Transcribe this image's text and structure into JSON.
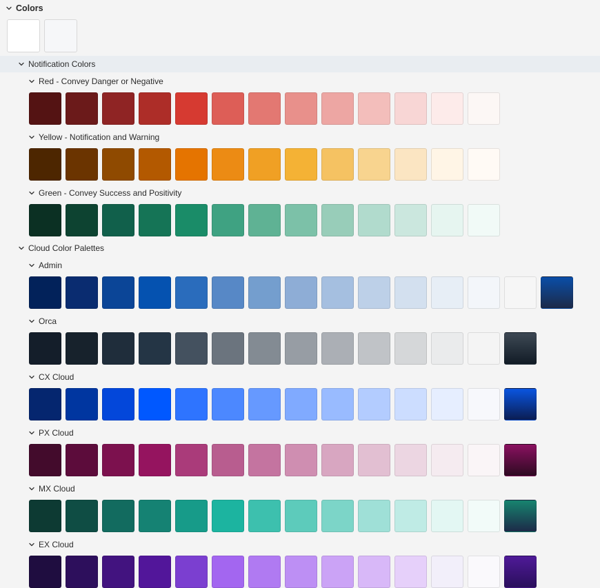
{
  "tree": {
    "root_title": "Colors",
    "notification_title": "Notification Colors",
    "cloud_title": "Cloud Color Palettes"
  },
  "top_swatches": [
    "#ffffff",
    "#f6f7f9"
  ],
  "groups": [
    {
      "title": "Red - Convey Danger or Negative",
      "colors": [
        "#541313",
        "#6b1a1a",
        "#8f2424",
        "#ad2d28",
        "#d63a31",
        "#dd5e57",
        "#e37872",
        "#e8908b",
        "#eda6a3",
        "#f3bebb",
        "#f8d6d5",
        "#fdebea",
        "#fcf7f5"
      ]
    },
    {
      "title": "Yellow - Notification and Warning",
      "colors": [
        "#4d2600",
        "#6b3400",
        "#8f4a00",
        "#b35900",
        "#e57400",
        "#ec8b14",
        "#f0a024",
        "#f4b235",
        "#f5c262",
        "#f8d48f",
        "#fbe5c2",
        "#fff5e6",
        "#fffaf5"
      ]
    },
    {
      "title": "Green - Convey Success and Positivity",
      "colors": [
        "#0b3023",
        "#0d4331",
        "#11604b",
        "#157456",
        "#1a8c68",
        "#3fa282",
        "#5fb294",
        "#7cc1a8",
        "#98cdb9",
        "#b1dbcd",
        "#cbe7de",
        "#e6f5f0",
        "#f1faf7"
      ]
    },
    {
      "title": "Admin",
      "colors": [
        "#02225a",
        "#0a2c70",
        "#0b4597",
        "#0552b0",
        "#2a6cbc",
        "#5788c6",
        "#749ece",
        "#8eadd6",
        "#a5bfe0",
        "#bdd0e8",
        "#d3e0ef",
        "#e7eef6",
        "#f3f6fa",
        "#f6f6f6",
        "gradient:#0a4ea8:#1c2a48"
      ]
    },
    {
      "title": "Orca",
      "colors": [
        "#141e2a",
        "#17222c",
        "#1f2d3b",
        "#243545",
        "#44515f",
        "#6b747e",
        "#838b93",
        "#979da4",
        "#abafb5",
        "#c0c3c7",
        "#d5d7d9",
        "#eaebec",
        "#f4f4f4",
        "gradient:#3d4854:#121c26"
      ]
    },
    {
      "title": "CX Cloud",
      "colors": [
        "#05266f",
        "#0036a0",
        "#0347da",
        "#0058ff",
        "#2e74ff",
        "#4c88ff",
        "#6699ff",
        "#80aaff",
        "#99bbff",
        "#b3ccff",
        "#ccddff",
        "#e6eeff",
        "#f7f8fc",
        "gradient:#0a55e0:#0b1d52"
      ]
    },
    {
      "title": "PX Cloud",
      "colors": [
        "#430b2c",
        "#5c0c3b",
        "#7c114e",
        "#95145f",
        "#aa3b7a",
        "#b85d8f",
        "#c474a0",
        "#cf8eb1",
        "#d8a6c1",
        "#e2bfd2",
        "#ecd6e2",
        "#f5ebf0",
        "#faf5f7",
        "gradient:#8a1160:#2e0a22"
      ]
    },
    {
      "title": "MX Cloud",
      "colors": [
        "#0d3a33",
        "#0f4d44",
        "#126b5f",
        "#158273",
        "#179b89",
        "#1cb4a0",
        "#3dc0ae",
        "#5dcbbb",
        "#7cd5c8",
        "#9fe0d7",
        "#bfebe5",
        "#e3f7f3",
        "#f2fbf9",
        "gradient:#17846f:#1c2a48"
      ]
    },
    {
      "title": "EX Cloud",
      "colors": [
        "#1f0d40",
        "#2d0f5c",
        "#42137f",
        "#52169a",
        "#7b3fd0",
        "#a366f0",
        "#b07af2",
        "#bd8ff4",
        "#cba3f6",
        "#d8b8f8",
        "#e6d0fa",
        "#f2effa",
        "#faf9fc",
        "gradient:#4f1a98:#2a0f5c"
      ]
    }
  ]
}
